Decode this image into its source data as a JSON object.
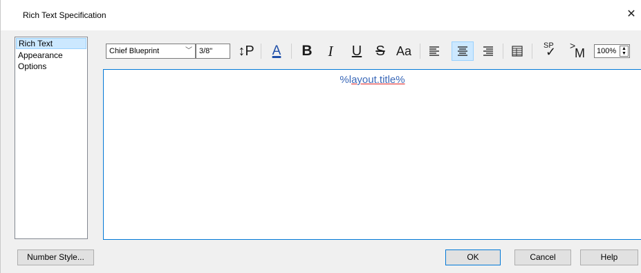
{
  "window": {
    "title": "Rich Text Specification",
    "close_glyph": "✕"
  },
  "sidebar": {
    "items": [
      {
        "label": "Rich Text",
        "selected": true
      },
      {
        "label": "Appearance",
        "selected": false
      },
      {
        "label": "Options",
        "selected": false
      }
    ]
  },
  "toolbar": {
    "font_family": "Chief Blueprint",
    "font_size": "3/8\"",
    "paragraph_spacing_label": "↕P",
    "font_color_label": "A",
    "bold_label": "B",
    "italic_label": "I",
    "underline_label": "U",
    "strikethrough_label": "S",
    "case_label": "Aa",
    "spellcheck_label": "SP",
    "macro_label": "M",
    "zoom": "100%",
    "alignment": "center",
    "accent": "#0078d7"
  },
  "editor": {
    "text_before": "%l",
    "text_underlined": "ayout.title%",
    "text_color": "#3a68b8"
  },
  "buttons": {
    "number_style": "Number Style...",
    "ok": "OK",
    "cancel": "Cancel",
    "help": "Help"
  }
}
